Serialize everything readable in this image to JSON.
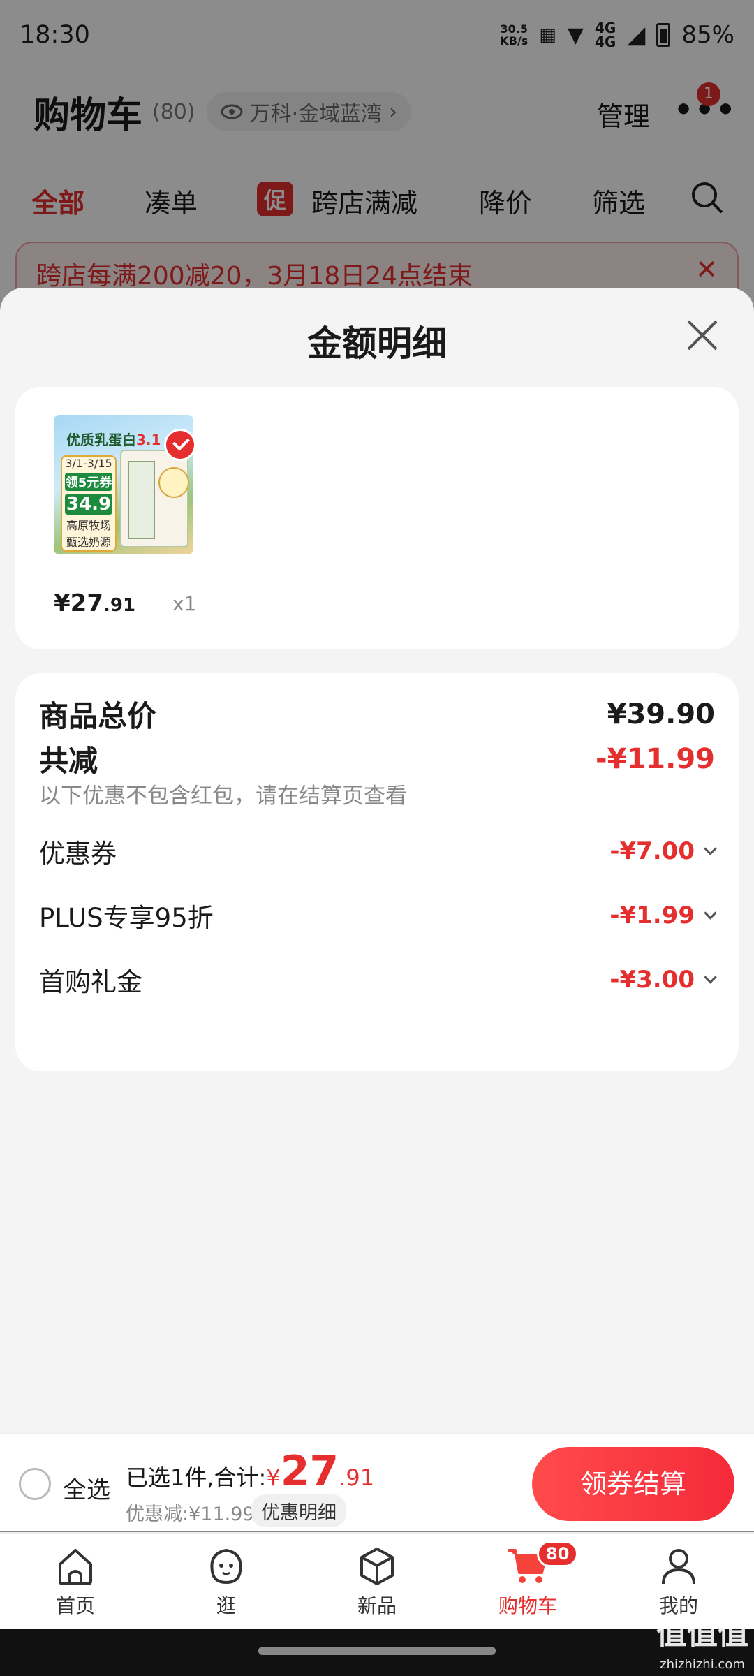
{
  "status_bar": {
    "time": "18:30",
    "speed": "30.5",
    "speed_unit": "KB/s",
    "network": "4G",
    "network2": "4G",
    "battery": "85%"
  },
  "header": {
    "title": "购物车",
    "count": "(80)",
    "location": "万科·金域蓝湾",
    "manage": "管理",
    "notification_count": "1"
  },
  "tabs": [
    {
      "label": "全部",
      "active": true
    },
    {
      "label": "凑单"
    },
    {
      "label": "跨店满减",
      "badge": "促"
    },
    {
      "label": "降价"
    },
    {
      "label": "筛选"
    }
  ],
  "banner": {
    "text": "跨店每满200减20，3月18日24点结束"
  },
  "sheet": {
    "title": "金额明细",
    "product": {
      "image_texts": {
        "headline": "优质乳蛋白",
        "headline_num": "3.1",
        "date": "3/1-3/15",
        "coupon": "领5元券",
        "price": "34.9",
        "line1": "高原牧场",
        "line2": "甄选奶源"
      },
      "price_int": "¥27",
      "price_dec": ".91",
      "quantity": "x1"
    },
    "breakdown": {
      "total_label": "商品总价",
      "total_value": "¥39.90",
      "reduce_label": "共减",
      "reduce_value": "-¥11.99",
      "note": "以下优惠不包含红包，请在结算页查看",
      "items": [
        {
          "label": "优惠券",
          "value": "-¥7.00"
        },
        {
          "label": "PLUS专享95折",
          "value": "-¥1.99"
        },
        {
          "label": "首购礼金",
          "value": "-¥3.00"
        }
      ]
    }
  },
  "bottom_bar": {
    "select_all": "全选",
    "summary_prefix": "已选1件,合计:",
    "currency": "¥",
    "total_int": "27",
    "total_dec": ".91",
    "discount": "优惠减:¥11.99",
    "detail_button": "优惠明细",
    "checkout_button": "领券结算"
  },
  "nav": {
    "items": [
      {
        "label": "首页"
      },
      {
        "label": "逛"
      },
      {
        "label": "新品"
      },
      {
        "label": "购物车",
        "badge": "80",
        "active": true
      },
      {
        "label": "我的"
      }
    ]
  },
  "watermark": {
    "text": "值值值",
    "sub": "zhizhizhi.com"
  },
  "colors": {
    "accent": "#e52e2e",
    "background": "#f4f4f4"
  }
}
